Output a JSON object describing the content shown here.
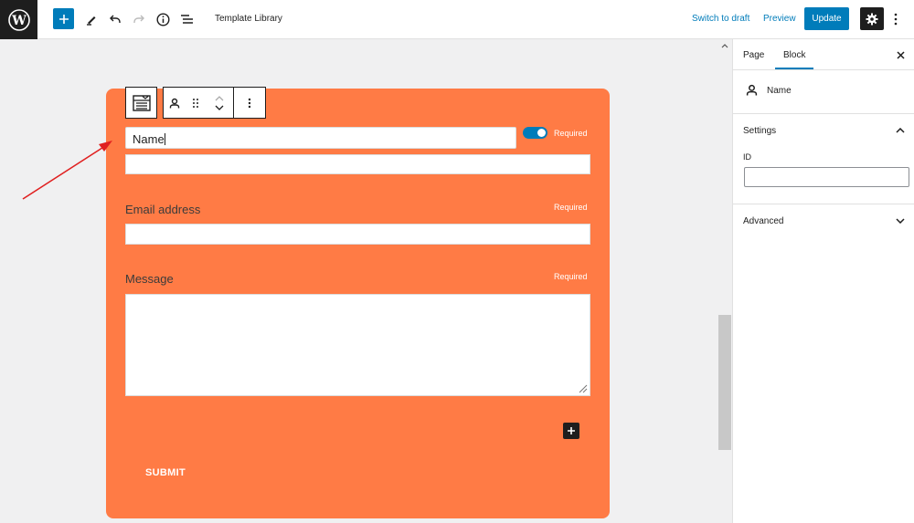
{
  "topbar": {
    "doc_title": "Template Library",
    "switch_to_draft": "Switch to draft",
    "preview": "Preview",
    "update": "Update"
  },
  "form": {
    "name_label": "Name",
    "email_label": "Email address",
    "message_label": "Message",
    "required": "Required",
    "submit": "SUBMIT",
    "name_required_enabled": true
  },
  "sidebar": {
    "tabs": [
      "Page",
      "Block"
    ],
    "active_tab": "Block",
    "block_name": "Name",
    "settings_title": "Settings",
    "id_label": "ID",
    "id_value": "",
    "advanced_title": "Advanced"
  },
  "colors": {
    "accent": "#007cba",
    "card": "#ff7b45",
    "annotation_arrow": "#e02020"
  }
}
